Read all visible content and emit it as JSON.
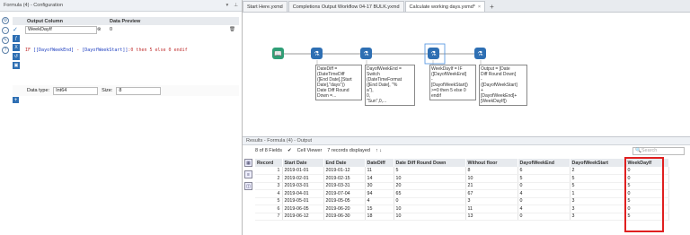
{
  "config": {
    "title": "Formula (4) - Configuration",
    "col_output": "Output Column",
    "col_preview": "Data Preview",
    "output_field": "WeekDayIf",
    "preview_value": "0",
    "expr_parts": [
      "IF ",
      "[[DayofWeekEnd]",
      " - ",
      "[DayofWeekStart]]",
      ":0 then 5 else 0 endif"
    ],
    "datatype_label": "Data type:",
    "datatype_value": "Int64",
    "size_label": "Size:",
    "size_value": "8"
  },
  "tabs": [
    {
      "label": "Start Here.yxmd"
    },
    {
      "label": "Completions Output Workflow 04-17 BULK.yxmd"
    },
    {
      "label": "Calculate working days.yxmd*"
    }
  ],
  "annotations": [
    "DateDiff =\n(DateTimeDiff\n([End Date],[Start\nDate],\"days\"))\nDate Diff Round\nDown =...",
    "DayofWeekEnd =\nSwitch\n(DateTimeFormat\n([End Date], \"%\na\"),\n0,\n\"Sun\",0,...",
    "WeekDayIf = IF\n([DayofWeekEnd]\n-\n[DayofWeekStart])\n>=0 then 5 else 0\nendif",
    "Output = [Date\nDiff Round Down]\n-\n([DayofWeekStart]\n+\n[DayofWeekEnd]+\n[WeekDayIf])"
  ],
  "results": {
    "title": "Results - Formula (4) - Output",
    "fields": "8 of 8 Fields",
    "viewer": "Cell Viewer",
    "records": "7 records displayed",
    "search": "Search",
    "headers": [
      "Record",
      "Start Date",
      "End Date",
      "DateDiff",
      "Date Diff Round Down",
      "Without floor",
      "DayofWeekEnd",
      "DayofWeekStart",
      "WeekDayIf"
    ],
    "rows": [
      [
        "1",
        "2019-01-01",
        "2019-01-12",
        "11",
        "5",
        "8",
        "6",
        "2",
        "0"
      ],
      [
        "2",
        "2019-02-01",
        "2019-02-15",
        "14",
        "10",
        "10",
        "5",
        "5",
        "0"
      ],
      [
        "3",
        "2019-03-01",
        "2019-03-31",
        "30",
        "20",
        "21",
        "0",
        "5",
        "5"
      ],
      [
        "4",
        "2019-04-01",
        "2019-07-04",
        "94",
        "65",
        "67",
        "4",
        "1",
        "0"
      ],
      [
        "5",
        "2019-05-01",
        "2019-05-05",
        "4",
        "0",
        "3",
        "0",
        "3",
        "5"
      ],
      [
        "6",
        "2019-06-05",
        "2019-06-20",
        "15",
        "10",
        "11",
        "4",
        "3",
        "0"
      ],
      [
        "7",
        "2019-06-12",
        "2019-06-30",
        "18",
        "10",
        "13",
        "0",
        "3",
        "5"
      ]
    ]
  }
}
